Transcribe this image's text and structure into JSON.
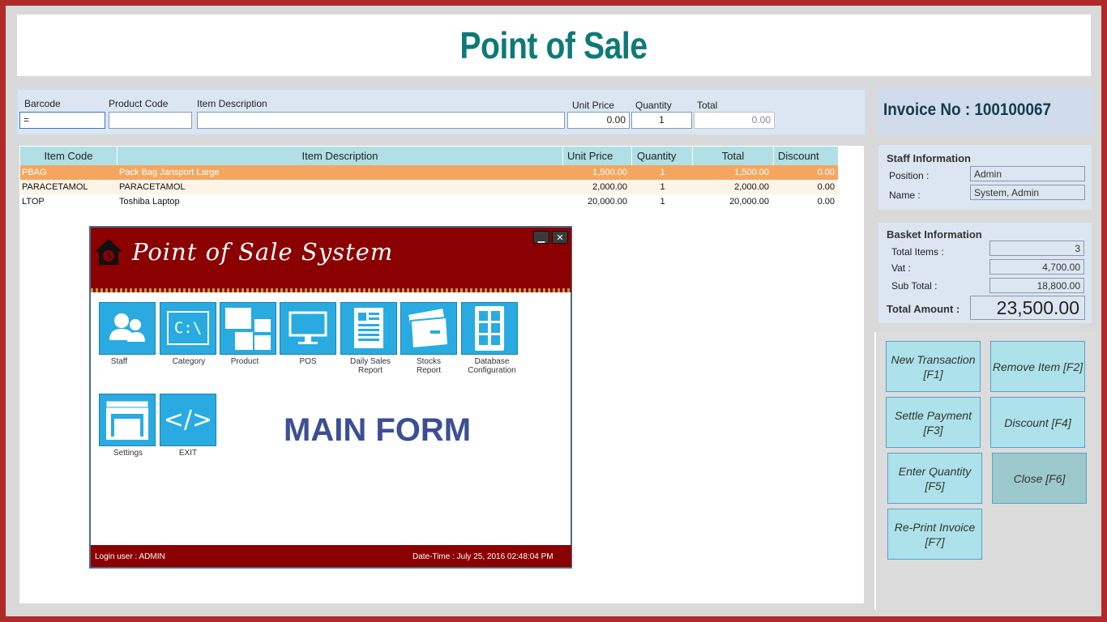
{
  "app": {
    "title": "Point of Sale"
  },
  "entry": {
    "barcode_label": "Barcode",
    "barcode_value": "=",
    "product_code_label": "Product Code",
    "product_code_value": "",
    "item_description_label": "Item Description",
    "item_description_value": "",
    "unit_price_label": "Unit Price",
    "unit_price_value": "0.00",
    "quantity_label": "Quantity",
    "quantity_value": "1",
    "total_label": "Total",
    "total_value": "0.00"
  },
  "grid": {
    "columns": [
      "Item Code",
      "Item Description",
      "Unit Price",
      "Quantity",
      "Total",
      "Discount"
    ],
    "rows": [
      {
        "code": "PBAG",
        "description": "Pack Bag Jansport Large",
        "unit_price": "1,500.00",
        "quantity": "1",
        "total": "1,500.00",
        "discount": "0.00"
      },
      {
        "code": "PARACETAMOL",
        "description": "PARACETAMOL",
        "unit_price": "2,000.00",
        "quantity": "1",
        "total": "2,000.00",
        "discount": "0.00"
      },
      {
        "code": "LTOP",
        "description": "Toshiba Laptop",
        "unit_price": "20,000.00",
        "quantity": "1",
        "total": "20,000.00",
        "discount": "0.00"
      }
    ]
  },
  "invoice": {
    "label": "Invoice No : ",
    "number": "100100067"
  },
  "staff": {
    "title": "Staff Information",
    "position_label": "Position :",
    "position_value": "Admin",
    "name_label": "Name :",
    "name_value": "System, Admin"
  },
  "basket": {
    "title": "Basket Information",
    "total_items_label": "Total Items :",
    "total_items_value": "3",
    "vat_label": "Vat :",
    "vat_value": "4,700.00",
    "sub_total_label": "Sub Total :",
    "sub_total_value": "18,800.00",
    "total_amount_label": "Total Amount :",
    "total_amount_value": "23,500.00"
  },
  "actions": {
    "new_transaction": "New Transaction [F1]",
    "remove_item": "Remove Item [F2]",
    "settle_payment": "Settle Payment [F3]",
    "discount": "Discount [F4]",
    "enter_quantity": "Enter Quantity [F5]",
    "close": "Close [F6]",
    "reprint_invoice": "Re-Print Invoice [F7]"
  },
  "main_form": {
    "title": "Point of Sale System",
    "watermark": "MAIN FORM",
    "tiles": [
      "Staff",
      "Category",
      "Product",
      "POS",
      "Daily Sales Report",
      "Stocks Report",
      "Database Configuration",
      "Settings",
      "EXIT"
    ],
    "category_glyph": "C:\\",
    "exit_glyph": "</>",
    "footer_user": "Login user : ADMIN",
    "footer_datetime": "Date-Time : July 25, 2016 02:48:04 PM"
  },
  "colors": {
    "frame": "#b02a2a",
    "title_teal": "#0e7a78",
    "selected_row": "#f4a660",
    "button_fill": "#ade2ea",
    "main_form_header": "#8b0000",
    "tile_blue": "#29abe2"
  }
}
